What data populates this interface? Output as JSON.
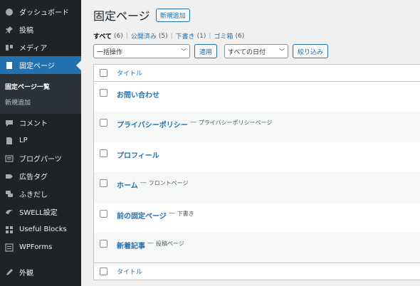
{
  "sidebar": {
    "items": [
      {
        "label": "ダッシュボード",
        "icon": "dashboard-icon"
      },
      {
        "label": "投稿",
        "icon": "pin-icon"
      },
      {
        "label": "メディア",
        "icon": "media-icon"
      },
      {
        "label": "固定ページ",
        "icon": "page-icon",
        "active": true
      },
      {
        "label": "コメント",
        "icon": "comment-icon"
      },
      {
        "label": "LP",
        "icon": "lp-icon"
      },
      {
        "label": "ブログパーツ",
        "icon": "blogparts-icon"
      },
      {
        "label": "広告タグ",
        "icon": "ad-tag-icon"
      },
      {
        "label": "ふきだし",
        "icon": "balloon-icon"
      },
      {
        "label": "SWELL設定",
        "icon": "swell-icon"
      },
      {
        "label": "Useful Blocks",
        "icon": "blocks-icon"
      },
      {
        "label": "WPForms",
        "icon": "wpforms-icon"
      },
      {
        "label": "外観",
        "icon": "appearance-icon"
      }
    ],
    "submenu": [
      {
        "label": "固定ページ一覧",
        "current": true
      },
      {
        "label": "新規追加",
        "current": false
      }
    ]
  },
  "header": {
    "title": "固定ページ",
    "add_new": "新規追加"
  },
  "filters": {
    "all": {
      "label": "すべて",
      "count": "(6)"
    },
    "published": {
      "label": "公開済み",
      "count": "(5)"
    },
    "draft": {
      "label": "下書き",
      "count": "(1)"
    },
    "trash": {
      "label": "ゴミ箱",
      "count": "(6)"
    },
    "separator": "|"
  },
  "tablenav": {
    "bulk_action": "一括操作",
    "apply": "適用",
    "date_filter": "すべての日付",
    "filter": "絞り込み"
  },
  "table": {
    "header": "タイトル",
    "footer": "タイトル",
    "dash": "—",
    "rows": [
      {
        "title": "お問い合わせ",
        "state": ""
      },
      {
        "title": "プライバシーポリシー",
        "state": "プライバシーポリシーページ"
      },
      {
        "title": "プロフィール",
        "state": ""
      },
      {
        "title": "ホーム",
        "state": "フロントページ"
      },
      {
        "title": "前の固定ページ",
        "state": "下書き"
      },
      {
        "title": "新着記事",
        "state": "投稿ページ"
      }
    ]
  },
  "colors": {
    "sidebar_bg": "#1d2327",
    "active_bg": "#2271b1",
    "link": "#2271b1"
  }
}
